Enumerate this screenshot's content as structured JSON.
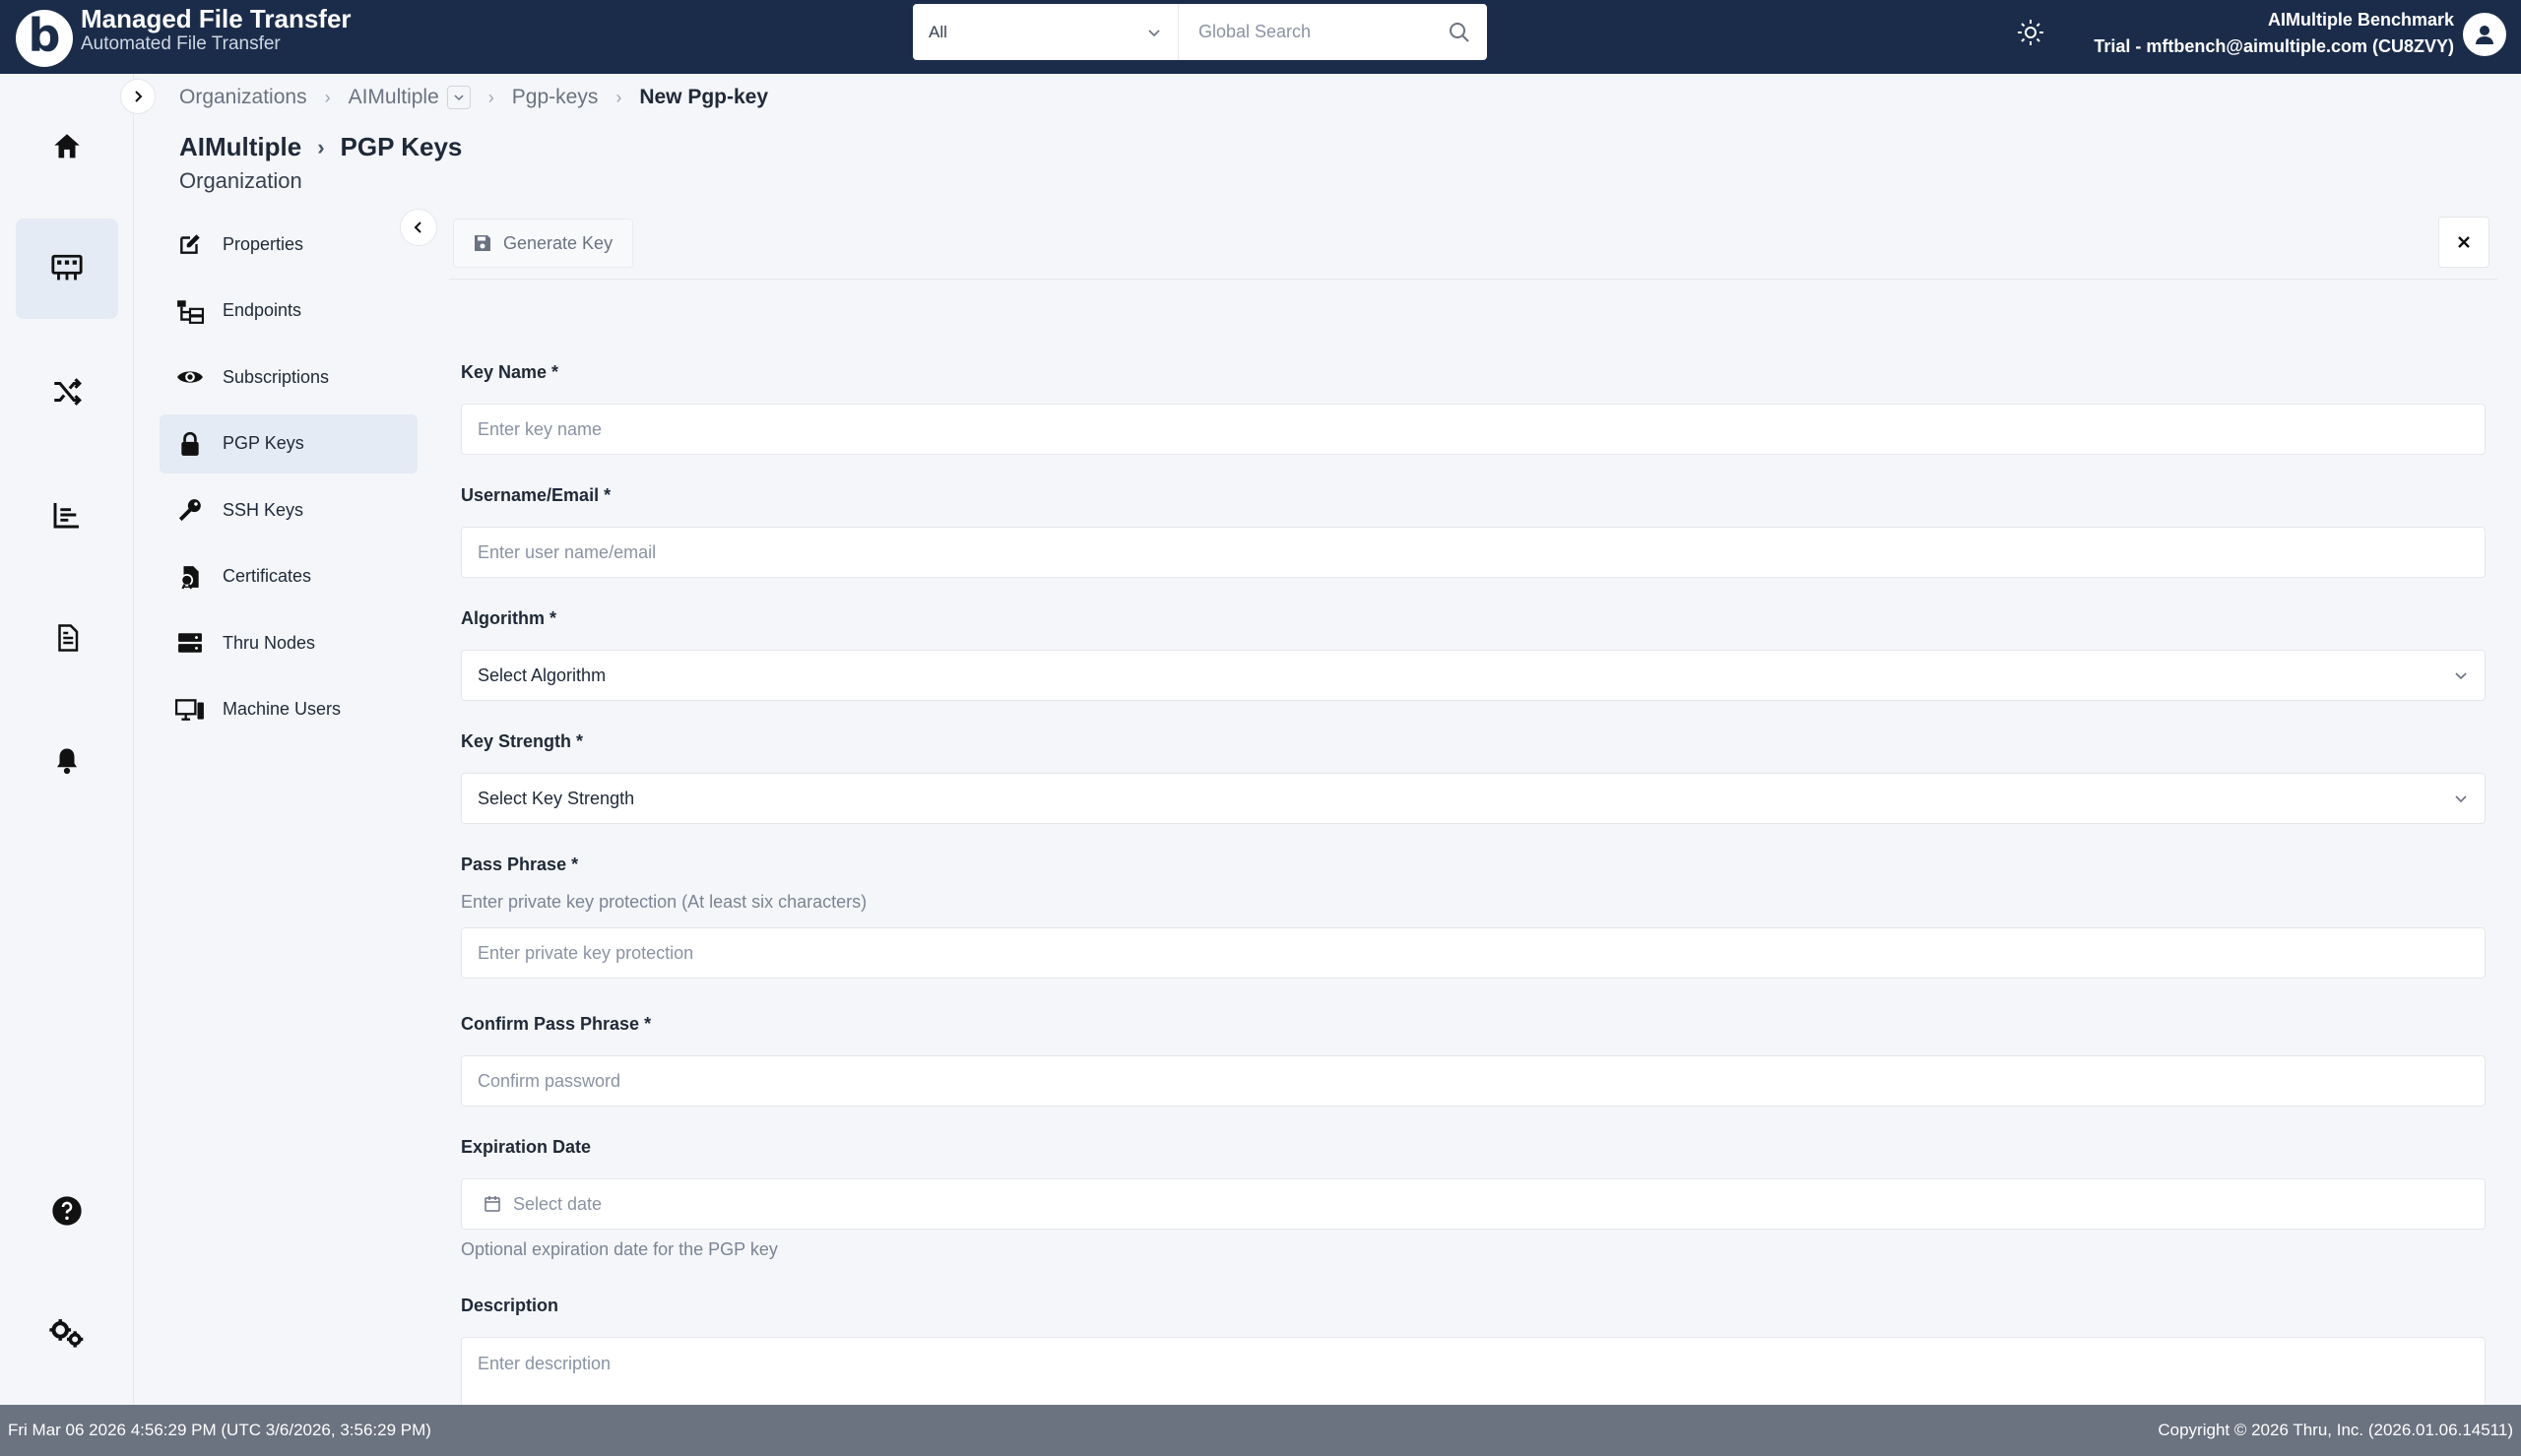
{
  "header": {
    "brand_title": "Managed File Transfer",
    "brand_subtitle": "Automated File Transfer",
    "logo_letter": "b",
    "search_scope": "All",
    "search_placeholder": "Global Search",
    "user_name": "AIMultiple Benchmark",
    "user_email": "Trial - mftbench@aimultiple.com (CU8ZVY)"
  },
  "rail": {
    "items": [
      "home-icon",
      "dashboard-icon",
      "shuffle-icon",
      "reports-icon",
      "document-icon",
      "bell-icon",
      "help-icon",
      "settings-icon"
    ],
    "active": "dashboard-icon"
  },
  "breadcrumb": {
    "items": [
      "Organizations",
      "AIMultiple",
      "Pgp-keys"
    ],
    "current": "New Pgp-key"
  },
  "page": {
    "org": "AIMultiple",
    "section": "PGP Keys",
    "subtitle": "Organization"
  },
  "subnav": {
    "items": [
      {
        "label": "Properties",
        "icon": "edit-icon"
      },
      {
        "label": "Endpoints",
        "icon": "endpoints-icon"
      },
      {
        "label": "Subscriptions",
        "icon": "eye-icon"
      },
      {
        "label": "PGP Keys",
        "icon": "lock-icon"
      },
      {
        "label": "SSH Keys",
        "icon": "key-icon"
      },
      {
        "label": "Certificates",
        "icon": "certificate-icon"
      },
      {
        "label": "Thru Nodes",
        "icon": "server-icon"
      },
      {
        "label": "Machine Users",
        "icon": "computer-icon"
      }
    ],
    "active": "PGP Keys"
  },
  "toolbar": {
    "generate_label": "Generate Key"
  },
  "form": {
    "key_name": {
      "label": "Key Name *",
      "placeholder": "Enter key name"
    },
    "username": {
      "label": "Username/Email *",
      "placeholder": "Enter user name/email"
    },
    "algorithm": {
      "label": "Algorithm *",
      "value": "Select Algorithm"
    },
    "key_strength": {
      "label": "Key Strength *",
      "value": "Select Key Strength"
    },
    "pass_phrase": {
      "label": "Pass Phrase *",
      "hint": "Enter private key protection (At least six characters)",
      "placeholder": "Enter private key protection"
    },
    "confirm_pass": {
      "label": "Confirm Pass Phrase *",
      "placeholder": "Confirm password"
    },
    "expiration": {
      "label": "Expiration Date",
      "placeholder": "Select date",
      "hint": "Optional expiration date for the PGP key"
    },
    "description": {
      "label": "Description",
      "placeholder": "Enter description"
    }
  },
  "status": {
    "left": "Fri Mar 06 2026 4:56:29 PM (UTC 3/6/2026, 3:56:29 PM)",
    "right": "Copyright © 2026 Thru, Inc. (2026.01.06.14511)"
  },
  "colors": {
    "header_bg": "#1b2c4a",
    "active_bg": "#e4ebf4",
    "status_bg": "#6b7280"
  }
}
